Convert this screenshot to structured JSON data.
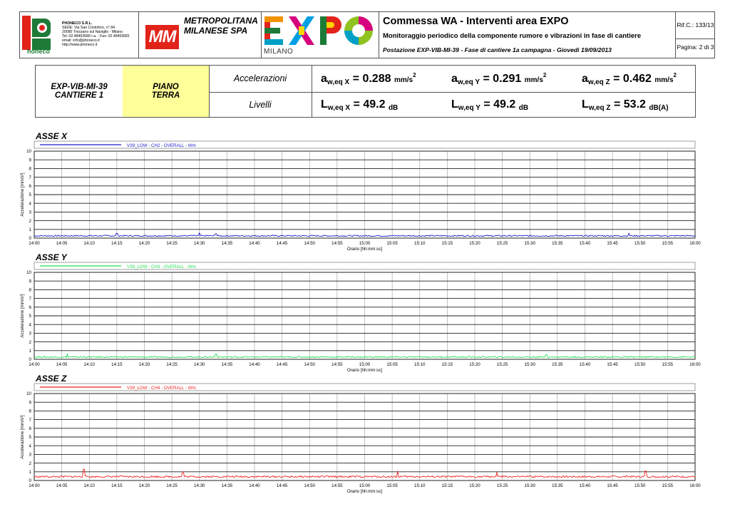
{
  "header": {
    "phoneco": {
      "logo_word": "honeco",
      "company": "PHONECO S.R.L.",
      "lines": [
        "SEDE: Via San Cristoforo, n° 84",
        "20090 Trezzano sul Naviglio - Milano",
        "Tel: 02.48463689 r.a. - Fax: 02.48463681",
        "email: info@phoneco.it",
        "http://www.phoneco.it"
      ]
    },
    "mm": {
      "logo": "MM",
      "name_line1": "METROPOLITANA",
      "name_line2": "MILANESE SPA"
    },
    "expo": {
      "city": "MILANO"
    },
    "title": "Commessa WA - Interventi area EXPO",
    "subtitle": "Monitoraggio periodico della componente rumore e vibrazioni in fase di cantiere",
    "station_line": "Postazione EXP-VIB-MI-39 - Fase di cantiere 1a campagna - Giovedì 19/09/2013",
    "ref": "Rif.C.: 133/13",
    "page": "Pagina: 2 di 3"
  },
  "summary": {
    "station_line1": "EXP-VIB-MI-39",
    "station_line2": "CANTIERE 1",
    "floor_line1": "PIANO",
    "floor_line2": "TERRA",
    "accel_label": "Accelerazioni",
    "levels_label": "Livelli",
    "accel": [
      {
        "pre": "a",
        "sub": "w,eq X",
        "value": "= 0.288",
        "unit": "mm/s",
        "exp": "2"
      },
      {
        "pre": "a",
        "sub": "w,eq Y",
        "value": "= 0.291",
        "unit": "mm/s",
        "exp": "2"
      },
      {
        "pre": "a",
        "sub": "w,eq Z",
        "value": "= 0.462",
        "unit": "mm/s",
        "exp": "2"
      }
    ],
    "levels": [
      {
        "pre": "L",
        "sub": "w,eq X",
        "value": "= 49.2",
        "unit": "dB"
      },
      {
        "pre": "L",
        "sub": "w,eq Y",
        "value": "= 49.2",
        "unit": "dB"
      },
      {
        "pre": "L",
        "sub": "w,eq Z",
        "value": "= 53.2",
        "unit": "dB(A)"
      }
    ]
  },
  "chart_data": [
    {
      "type": "line",
      "title": "ASSE X",
      "series": [
        {
          "name": "V39_LOW - CH2 - OVERALL - Wm",
          "color": "#1a1acc",
          "baseline": 0.25,
          "noise": 0.15,
          "spikes": [
            [
              14.25,
              0.55
            ],
            [
              14.5,
              0.6
            ],
            [
              14.55,
              0.5
            ],
            [
              15.8,
              0.55
            ]
          ]
        }
      ],
      "x_ticks": [
        "14:00",
        "14:05",
        "14:10",
        "14:15",
        "14:20",
        "14:25",
        "14:30",
        "14:35",
        "14:40",
        "14:45",
        "14:50",
        "14:55",
        "15:00",
        "15:05",
        "15:10",
        "15:15",
        "15:20",
        "15:25",
        "15:30",
        "15:35",
        "15:40",
        "15:45",
        "15:50",
        "15:55",
        "16:00"
      ],
      "xlim": [
        "14:00",
        "16:00"
      ],
      "ylim": [
        0,
        10
      ],
      "y_ticks": [
        0,
        1,
        2,
        3,
        4,
        5,
        6,
        7,
        8,
        9,
        10
      ],
      "xlabel": "Orario [hh:mm:ss]",
      "ylabel": "Accelerazione [mm/s²]",
      "grid": true,
      "legend": "top"
    },
    {
      "type": "line",
      "title": "ASSE Y",
      "series": [
        {
          "name": "V39_LOW - CH3 - OVERALL - Wm",
          "color": "#22dd55",
          "baseline": 0.25,
          "noise": 0.15,
          "spikes": [
            [
              14.1,
              0.6
            ],
            [
              14.55,
              0.6
            ],
            [
              15.55,
              0.55
            ]
          ]
        }
      ],
      "x_ticks": [
        "14:00",
        "14:05",
        "14:10",
        "14:15",
        "14:20",
        "14:25",
        "14:30",
        "14:35",
        "14:40",
        "14:45",
        "14:50",
        "14:55",
        "15:00",
        "15:05",
        "15:10",
        "15:15",
        "15:20",
        "15:25",
        "15:30",
        "15:35",
        "15:40",
        "15:45",
        "15:50",
        "15:55",
        "16:00"
      ],
      "xlim": [
        "14:00",
        "16:00"
      ],
      "ylim": [
        0,
        10
      ],
      "y_ticks": [
        0,
        1,
        2,
        3,
        4,
        5,
        6,
        7,
        8,
        9,
        10
      ],
      "xlabel": "Orario [hh:mm:ss]",
      "ylabel": "Accelerazione [mm/s²]",
      "grid": true,
      "legend": "top"
    },
    {
      "type": "line",
      "title": "ASSE Z",
      "series": [
        {
          "name": "V39_LOW - CH4 - OVERALL - Wm",
          "color": "#ee2222",
          "baseline": 0.42,
          "noise": 0.2,
          "spikes": [
            [
              14.15,
              1.3
            ],
            [
              14.45,
              1.0
            ],
            [
              15.1,
              1.1
            ],
            [
              15.4,
              0.95
            ],
            [
              15.85,
              1.1
            ]
          ]
        }
      ],
      "x_ticks": [
        "14:00",
        "14:05",
        "14:10",
        "14:15",
        "14:20",
        "14:25",
        "14:30",
        "14:35",
        "14:40",
        "14:45",
        "14:50",
        "14:55",
        "15:00",
        "15:05",
        "15:10",
        "15:15",
        "15:20",
        "15:25",
        "15:30",
        "15:35",
        "15:40",
        "15:45",
        "15:50",
        "15:55",
        "16:00"
      ],
      "xlim": [
        "14:00",
        "16:00"
      ],
      "ylim": [
        0,
        10
      ],
      "y_ticks": [
        0,
        1,
        2,
        3,
        4,
        5,
        6,
        7,
        8,
        9,
        10
      ],
      "xlabel": "Orario [hh:mm:ss]",
      "ylabel": "Accelerazione [mm/s²]",
      "grid": true,
      "legend": "top"
    }
  ]
}
